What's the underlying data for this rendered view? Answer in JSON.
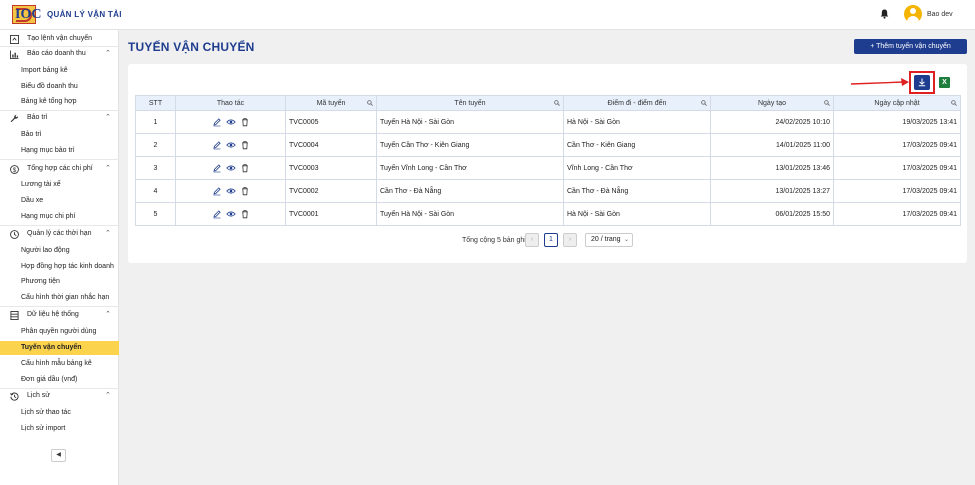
{
  "header": {
    "logo_text": "IOC",
    "app_title": "QUẢN LÝ VẬN TẢI",
    "user_name": "Bao dev"
  },
  "sidebar": {
    "create_order": "Tạo lệnh vận chuyển",
    "groups": [
      {
        "label": "Báo cáo doanh thu",
        "icon": "chart-icon",
        "items": [
          "Import bảng kê",
          "Biểu đồ doanh thu",
          "Bảng kê tổng hợp"
        ]
      },
      {
        "label": "Bảo trì",
        "icon": "wrench-icon",
        "items": [
          "Bảo trì",
          "Hạng mục bảo trì"
        ]
      },
      {
        "label": "Tổng hợp các chi phí",
        "icon": "dollar-icon",
        "items": [
          "Lương tài xế",
          "Dầu xe",
          "Hạng mục chi phí"
        ]
      },
      {
        "label": "Quản lý các thời hạn",
        "icon": "clock-icon",
        "items": [
          "Người lao động",
          "Hợp đồng hợp tác kinh doanh",
          "Phương tiện",
          "Cấu hình thời gian nhắc hạn"
        ]
      },
      {
        "label": "Dữ liệu hệ thống",
        "icon": "database-icon",
        "items": [
          "Phân quyền người dùng",
          "Tuyến vận chuyển",
          "Cấu hình mẫu bảng kê",
          "Đơn giá dầu (vnđ)"
        ]
      },
      {
        "label": "Lịch sử",
        "icon": "history-icon",
        "items": [
          "Lịch sử thao tác",
          "Lịch sử import"
        ]
      }
    ],
    "active_item": "Tuyến vận chuyển"
  },
  "main": {
    "page_title": "TUYẾN VẬN CHUYỂN",
    "add_button": "+ Thêm tuyến vận chuyển",
    "excel_label": "X",
    "table": {
      "columns": [
        "STT",
        "Thao tác",
        "Mã tuyến",
        "Tên tuyến",
        "Điểm đi - điểm đến",
        "Ngày tạo",
        "Ngày cập nhật"
      ],
      "rows": [
        {
          "stt": "1",
          "code": "TVC0005",
          "name": "Tuyến Hà Nội - Sài Gòn",
          "route": "Hà Nội - Sài Gòn",
          "created": "24/02/2025 10:10",
          "updated": "19/03/2025 13:41"
        },
        {
          "stt": "2",
          "code": "TVC0004",
          "name": "Tuyến Cần Thơ - Kiên Giang",
          "route": "Cần Thơ - Kiên Giang",
          "created": "14/01/2025 11:00",
          "updated": "17/03/2025 09:41"
        },
        {
          "stt": "3",
          "code": "TVC0003",
          "name": "Tuyến Vĩnh Long - Cần Thơ",
          "route": "Vĩnh Long - Cần Thơ",
          "created": "13/01/2025 13:46",
          "updated": "17/03/2025 09:41"
        },
        {
          "stt": "4",
          "code": "TVC0002",
          "name": "Cần Thơ - Đà Nẵng",
          "route": "Cần Thơ - Đà Nẵng",
          "created": "13/01/2025 13:27",
          "updated": "17/03/2025 09:41"
        },
        {
          "stt": "5",
          "code": "TVC0001",
          "name": "Tuyến Hà Nội - Sài Gòn",
          "route": "Hà Nội - Sài Gòn",
          "created": "06/01/2025 15:50",
          "updated": "17/03/2025 09:41"
        }
      ]
    },
    "pagination": {
      "total_text": "Tổng cộng 5 bản ghi",
      "current_page": "1",
      "prev": "‹",
      "next": "›",
      "per_page": "20 / trang"
    }
  }
}
